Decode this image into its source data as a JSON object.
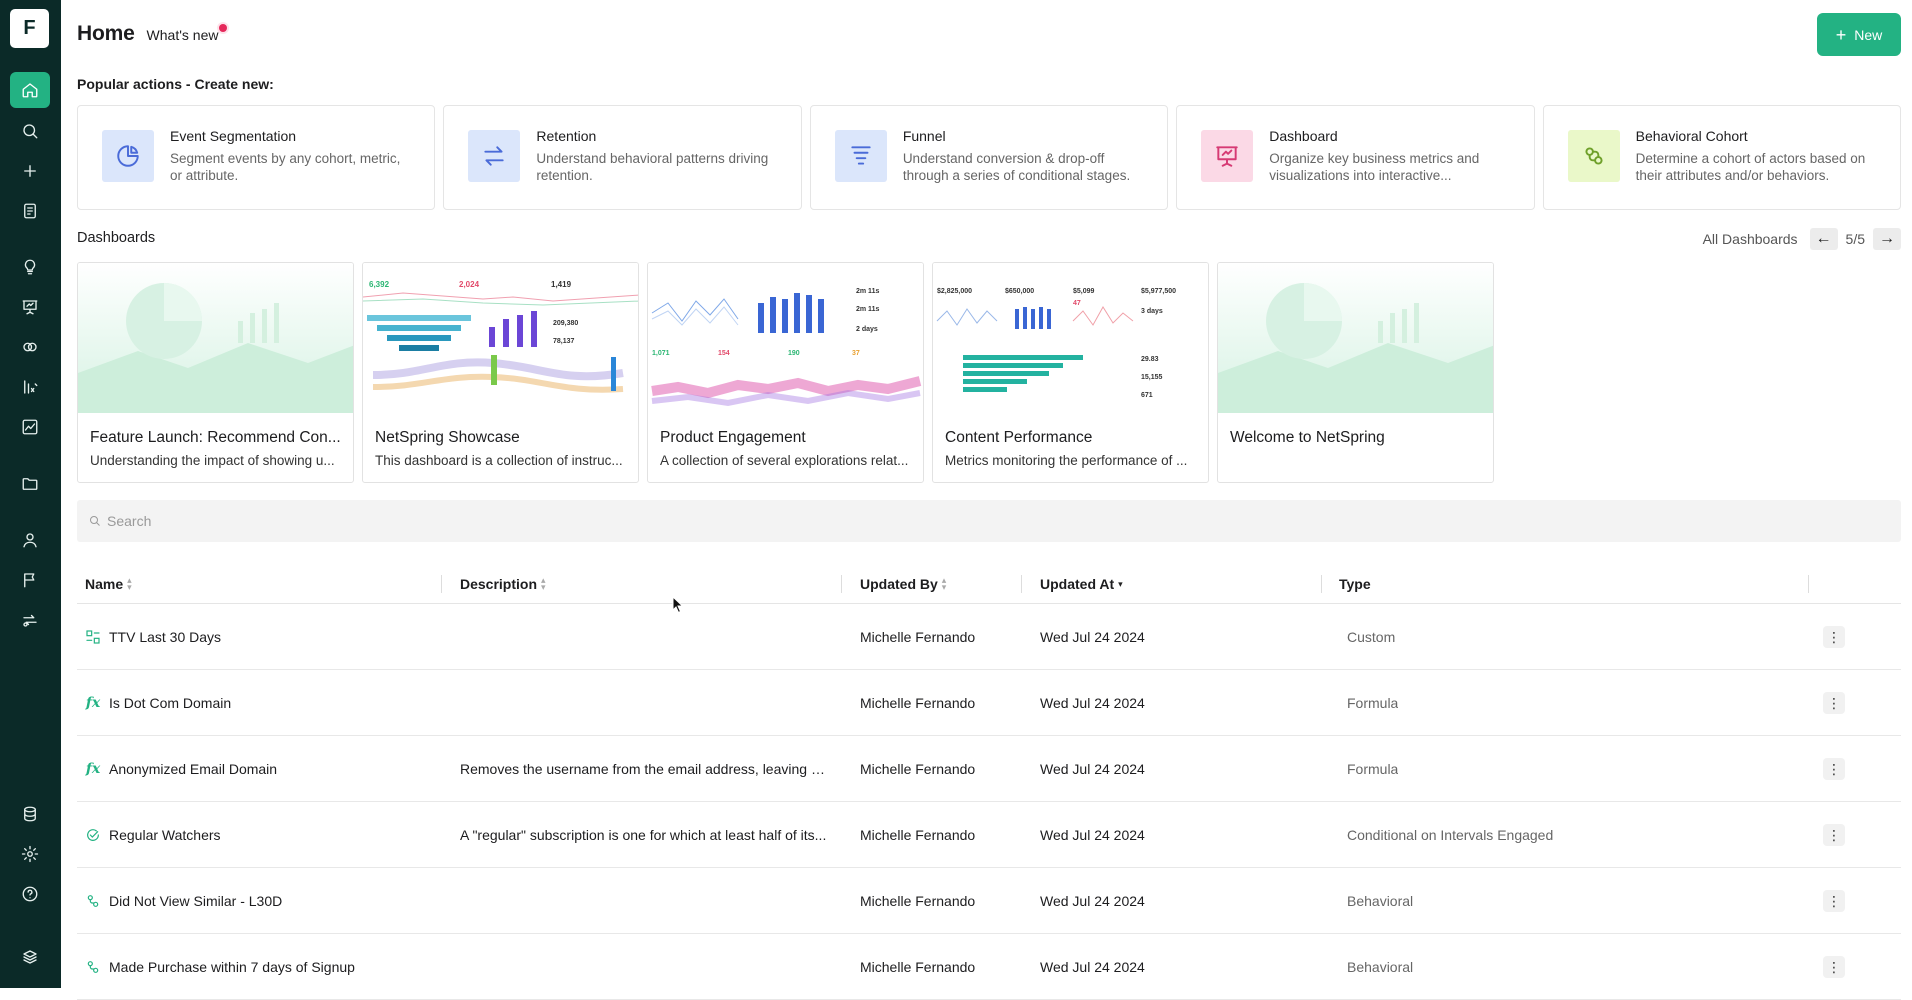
{
  "sidebar": {
    "logo": "F",
    "items": [
      {
        "icon": "home-icon",
        "active": true
      },
      {
        "icon": "search-icon"
      },
      {
        "icon": "plus-icon"
      },
      {
        "icon": "notebook-icon"
      },
      {
        "icon": "lightbulb-icon"
      },
      {
        "icon": "presentation-icon"
      },
      {
        "icon": "cohort-icon"
      },
      {
        "icon": "metrics-icon"
      },
      {
        "icon": "chart-icon"
      },
      {
        "icon": "folder-icon"
      },
      {
        "icon": "user-icon"
      },
      {
        "icon": "flag-icon"
      },
      {
        "icon": "sync-icon"
      },
      {
        "icon": "database-icon"
      },
      {
        "icon": "gear-icon"
      },
      {
        "icon": "help-icon"
      },
      {
        "icon": "brand-icon"
      }
    ]
  },
  "header": {
    "title": "Home",
    "whats_new": "What's new",
    "new_button": "New"
  },
  "popular": {
    "title": "Popular actions - Create new:",
    "cards": [
      {
        "title": "Event Segmentation",
        "desc": "Segment events by any cohort, metric, or attribute.",
        "icon": "pie-icon",
        "bg": "#dbe6fb",
        "fg": "#4a6bd8"
      },
      {
        "title": "Retention",
        "desc": "Understand behavioral patterns driving retention.",
        "icon": "swap-icon",
        "bg": "#dbe6fb",
        "fg": "#4a6bd8"
      },
      {
        "title": "Funnel",
        "desc": "Understand conversion & drop-off through a series of conditional stages.",
        "icon": "funnel-icon",
        "bg": "#dbe6fb",
        "fg": "#4a6bd8"
      },
      {
        "title": "Dashboard",
        "desc": "Organize key business metrics and visualizations into interactive...",
        "icon": "presentation-icon",
        "bg": "#fbd9e6",
        "fg": "#d63a74"
      },
      {
        "title": "Behavioral Cohort",
        "desc": "Determine a cohort of actors based on their attributes and/or behaviors.",
        "icon": "cohort-icon",
        "bg": "#eaf8c9",
        "fg": "#6fa02a"
      }
    ]
  },
  "dashboards": {
    "title": "Dashboards",
    "all_label": "All Dashboards",
    "pager": "5/5",
    "cards": [
      {
        "title": "Feature Launch: Recommend Con...",
        "desc": "Understanding the impact of showing u...",
        "thumb": "placeholder"
      },
      {
        "title": "NetSpring Showcase",
        "desc": "This dashboard is a collection of instruc...",
        "thumb": "showcase",
        "stats": [
          "6,392",
          "2,024",
          "1,419",
          "209,380",
          "78,137"
        ]
      },
      {
        "title": "Product Engagement",
        "desc": "A collection of several explorations relat...",
        "thumb": "engagement",
        "stats": [
          "2m 11s",
          "2m 11s",
          "2 days",
          "1,071",
          "154",
          "190",
          "37"
        ]
      },
      {
        "title": "Content Performance",
        "desc": "Metrics monitoring the performance of ...",
        "thumb": "content",
        "stats": [
          "$2,825,000",
          "$650,000",
          "$5,099",
          "$5,977,500",
          "47",
          "3 days",
          "29.83",
          "15,155",
          "671"
        ]
      },
      {
        "title": "Welcome to NetSpring",
        "desc": "",
        "thumb": "placeholder"
      }
    ]
  },
  "search": {
    "placeholder": "Search",
    "value": ""
  },
  "table": {
    "headers": {
      "name": "Name",
      "description": "Description",
      "updated_by": "Updated By",
      "updated_at": "Updated At",
      "type": "Type"
    },
    "rows": [
      {
        "name": "TTV Last 30 Days",
        "description": "",
        "updated_by": "Michelle Fernando",
        "updated_at": "Wed Jul 24 2024",
        "type": "Custom",
        "icon": "custom-icon"
      },
      {
        "name": "Is Dot Com Domain",
        "description": "",
        "updated_by": "Michelle Fernando",
        "updated_at": "Wed Jul 24 2024",
        "type": "Formula",
        "icon": "formula-icon"
      },
      {
        "name": "Anonymized Email Domain",
        "description": "Removes the username from the email address, leaving only t...",
        "updated_by": "Michelle Fernando",
        "updated_at": "Wed Jul 24 2024",
        "type": "Formula",
        "icon": "formula-icon"
      },
      {
        "name": "Regular Watchers",
        "description": "A \"regular\" subscription is one for which at least half of its...",
        "updated_by": "Michelle Fernando",
        "updated_at": "Wed Jul 24 2024",
        "type": "Conditional on Intervals Engaged",
        "icon": "interval-icon"
      },
      {
        "name": "Did Not View Similar - L30D",
        "description": "",
        "updated_by": "Michelle Fernando",
        "updated_at": "Wed Jul 24 2024",
        "type": "Behavioral",
        "icon": "cohort-icon"
      },
      {
        "name": "Made Purchase within 7 days of Signup",
        "description": "",
        "updated_by": "Michelle Fernando",
        "updated_at": "Wed Jul 24 2024",
        "type": "Behavioral",
        "icon": "cohort-icon"
      }
    ]
  },
  "colors": {
    "accent": "#23b283",
    "sidebar": "#0b2a28"
  }
}
